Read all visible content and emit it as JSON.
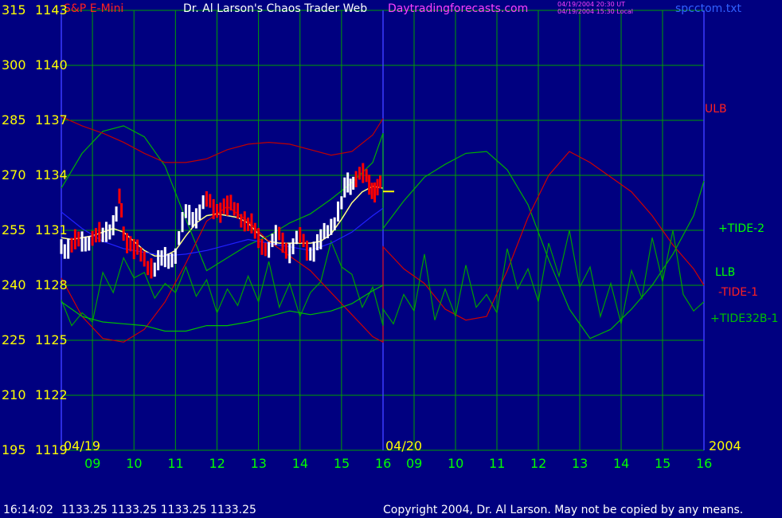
{
  "header": {
    "instrument": "S&P E-Mini",
    "site_title": "Dr. Al Larson's Chaos Trader Web",
    "site_url": "Daytradingforecasts.com",
    "stamp_ut": "04/19/2004 20:30 UT",
    "stamp_local": "04/19/2004 15:30 Local",
    "filename": "spcctom.txt"
  },
  "colors": {
    "background": "#000080",
    "grid": "#00a000",
    "divider": "#3a3aff",
    "price_up": "#ffffff",
    "price_down": "#ff0000",
    "average": "#ffff80",
    "tide_2": "#00b000",
    "tide_1": "#d00000",
    "tide32b_1": "#00a000",
    "band_upper": "#c00000",
    "band_lower": "#00c000",
    "blue_band": "#2020ff"
  },
  "axes": {
    "y_left_outer": [
      "315",
      "300",
      "285",
      "270",
      "255",
      "240",
      "225",
      "210",
      "195"
    ],
    "y_left_inner": [
      "1143",
      "1140",
      "1137",
      "1134",
      "1131",
      "1128",
      "1125",
      "1122",
      "1119"
    ],
    "x_day1_label": "04/19",
    "x_day2_label": "04/20",
    "x_year_label": "2004",
    "x_hours": [
      "09",
      "10",
      "11",
      "12",
      "13",
      "14",
      "15",
      "16",
      "09",
      "10",
      "11",
      "12",
      "13",
      "14",
      "15",
      "16"
    ]
  },
  "right_labels": {
    "ulb": "ULB",
    "tide_2": "+TIDE-2",
    "llb": "LLB",
    "tide_1": "-TIDE-1",
    "tide32b_1": "+TIDE32B-1"
  },
  "footer": {
    "time": "16:14:02",
    "quote": "1133.25 1133.25 1133.25 1133.25",
    "copyright": "Copyright 2004, Dr. Al Larson. May not be copied by any means."
  },
  "chart_data": {
    "type": "line",
    "title": "Dr. Al Larson's Chaos Trader Web",
    "xlabel": "",
    "ylabel": "",
    "ylim": [
      1119,
      1143
    ],
    "y2lim": [
      195,
      315
    ],
    "grid": true,
    "x_hours": [
      "09",
      "10",
      "11",
      "12",
      "13",
      "14",
      "15",
      "16",
      "09",
      "10",
      "11",
      "12",
      "13",
      "14",
      "15",
      "16"
    ],
    "x_range_hours": [
      8.25,
      16.0
    ],
    "series": [
      {
        "name": "S&P E-Mini",
        "kind": "price",
        "x": [
          8.25,
          8.5,
          8.75,
          9.0,
          9.25,
          9.5,
          9.65,
          9.75,
          10.0,
          10.25,
          10.5,
          10.75,
          11.0,
          11.25,
          11.5,
          11.75,
          12.0,
          12.25,
          12.5,
          12.75,
          13.0,
          13.25,
          13.5,
          13.75,
          14.0,
          14.25,
          14.5,
          14.75,
          15.0,
          15.15,
          15.35,
          15.6,
          15.8,
          16.0
        ],
        "values": [
          1130.0,
          1130.4,
          1130.1,
          1130.9,
          1130.4,
          1131.6,
          1132.6,
          1131.0,
          1129.9,
          1129.4,
          1129.0,
          1129.3,
          1129.9,
          1131.7,
          1132.0,
          1132.4,
          1132.3,
          1132.2,
          1132.1,
          1131.4,
          1130.4,
          1130.2,
          1130.5,
          1130.1,
          1130.4,
          1130.0,
          1130.3,
          1131.3,
          1132.5,
          1133.5,
          1134.0,
          1133.7,
          1133.4,
          1133.25
        ]
      },
      {
        "name": "Average",
        "kind": "average",
        "x": [
          8.25,
          8.5,
          8.75,
          9.0,
          9.25,
          9.5,
          9.75,
          10.0,
          10.25,
          10.5,
          10.75,
          11.0,
          11.25,
          11.5,
          11.75,
          12.0,
          12.25,
          12.5,
          12.75,
          13.0,
          13.25,
          13.5,
          13.75,
          14.0,
          14.25,
          14.5,
          14.75,
          15.0,
          15.25,
          15.5,
          15.75,
          16.0
        ],
        "values": [
          1130.6,
          1130.5,
          1130.6,
          1130.7,
          1130.9,
          1131.1,
          1130.9,
          1130.4,
          1129.9,
          1129.6,
          1129.6,
          1129.9,
          1130.7,
          1131.4,
          1131.8,
          1131.9,
          1131.8,
          1131.7,
          1131.4,
          1130.8,
          1130.4,
          1130.3,
          1130.3,
          1130.3,
          1130.3,
          1130.4,
          1130.8,
          1131.6,
          1132.5,
          1133.1,
          1133.4,
          1133.3
        ]
      },
      {
        "name": "+TIDE-2",
        "kind": "model",
        "x": [
          8.25,
          8.75,
          9.25,
          9.75,
          10.25,
          10.75,
          11.25,
          11.75,
          12.25,
          12.75,
          13.25,
          13.75,
          14.25,
          14.75,
          15.25,
          15.75,
          16.0,
          16.25,
          16.75,
          17.25,
          17.75,
          18.25,
          18.75,
          19.25,
          19.75,
          20.25,
          20.75,
          21.25,
          21.75,
          22.25,
          22.75,
          23.25,
          23.75,
          24.0
        ],
        "values": [
          1133.3,
          1135.2,
          1136.4,
          1136.7,
          1136.1,
          1134.5,
          1131.6,
          1128.8,
          1129.5,
          1130.2,
          1130.7,
          1131.4,
          1131.9,
          1132.7,
          1133.6,
          1134.7,
          1136.3,
          1131.1,
          1132.6,
          1133.9,
          1134.6,
          1135.2,
          1135.3,
          1134.3,
          1132.4,
          1129.4,
          1126.7,
          1125.1,
          1125.6,
          1126.7,
          1128.0,
          1129.7,
          1131.8,
          1133.7
        ]
      },
      {
        "name": "-TIDE-1",
        "kind": "model",
        "x": [
          8.25,
          8.75,
          9.25,
          9.75,
          10.25,
          10.75,
          11.25,
          11.75,
          12.25,
          12.75,
          13.25,
          13.75,
          14.25,
          14.75,
          15.25,
          15.75,
          16.0,
          16.25,
          16.75,
          17.25,
          17.75,
          18.25,
          18.75,
          19.25,
          19.75,
          20.25,
          20.75,
          21.25,
          21.75,
          22.25,
          22.75,
          23.25,
          23.75,
          24.0
        ],
        "values": [
          1128.4,
          1126.3,
          1125.1,
          1124.9,
          1125.6,
          1127.1,
          1129.2,
          1131.5,
          1132.3,
          1131.5,
          1130.4,
          1129.6,
          1128.8,
          1127.6,
          1126.4,
          1125.2,
          1124.9,
          1130.1,
          1128.9,
          1128.1,
          1126.7,
          1126.1,
          1126.3,
          1128.8,
          1131.7,
          1134.0,
          1135.3,
          1134.7,
          1133.9,
          1133.1,
          1131.8,
          1130.2,
          1128.9,
          1128.0
        ]
      },
      {
        "name": "+TIDE32B-1",
        "kind": "model",
        "x": [
          8.25,
          8.5,
          8.75,
          9.0,
          9.25,
          9.5,
          9.75,
          10.0,
          10.25,
          10.5,
          10.75,
          11.0,
          11.25,
          11.5,
          11.75,
          12.0,
          12.25,
          12.5,
          12.75,
          13.0,
          13.25,
          13.5,
          13.75,
          14.0,
          14.25,
          14.5,
          14.75,
          15.0,
          15.25,
          15.5,
          15.75,
          16.0,
          16.25,
          16.5,
          16.75,
          17.0,
          17.25,
          17.5,
          17.75,
          18.0,
          18.25,
          18.5,
          18.75,
          19.0,
          19.25,
          19.5,
          19.75,
          20.0,
          20.25,
          20.5,
          20.75,
          21.0,
          21.25,
          21.5,
          21.75,
          22.0,
          22.25,
          22.5,
          22.75,
          23.0,
          23.25,
          23.5,
          23.75,
          24.0
        ],
        "values": [
          1127.2,
          1125.8,
          1126.5,
          1126.0,
          1128.7,
          1127.6,
          1129.5,
          1128.4,
          1128.7,
          1127.3,
          1128.1,
          1127.6,
          1129.0,
          1127.4,
          1128.3,
          1126.5,
          1127.8,
          1126.9,
          1128.5,
          1127.1,
          1129.3,
          1126.8,
          1128.1,
          1126.3,
          1127.6,
          1128.2,
          1130.4,
          1129.0,
          1128.6,
          1126.8,
          1127.9,
          1125.8,
          1126.7,
          1125.9,
          1127.5,
          1126.6,
          1129.7,
          1126.1,
          1127.8,
          1126.3,
          1129.1,
          1126.8,
          1127.5,
          1126.5,
          1130.0,
          1127.8,
          1128.9,
          1127.1,
          1130.3,
          1128.5,
          1131.0,
          1127.9,
          1129.0,
          1126.3,
          1128.1,
          1125.9,
          1128.8,
          1127.3,
          1130.6,
          1128.2,
          1131.0,
          1127.5,
          1126.6,
          1127.1
        ]
      },
      {
        "name": "ULB",
        "kind": "band",
        "x": [
          8.25,
          8.75,
          9.25,
          9.75,
          10.25,
          10.75,
          11.25,
          11.75,
          12.25,
          12.75,
          13.25,
          13.75,
          14.25,
          14.75,
          15.25,
          15.75,
          16.0
        ],
        "values": [
          1137.2,
          1136.7,
          1136.3,
          1135.8,
          1135.2,
          1134.7,
          1134.7,
          1134.9,
          1135.4,
          1135.7,
          1135.8,
          1135.7,
          1135.4,
          1135.1,
          1135.3,
          1136.2,
          1137.1
        ]
      },
      {
        "name": "LLB",
        "kind": "band",
        "x": [
          8.25,
          8.75,
          9.25,
          9.75,
          10.25,
          10.75,
          11.25,
          11.75,
          12.25,
          12.75,
          13.25,
          13.75,
          14.25,
          14.75,
          15.25,
          15.75,
          16.0
        ],
        "values": [
          1127.1,
          1126.3,
          1126.0,
          1125.9,
          1125.8,
          1125.5,
          1125.5,
          1125.8,
          1125.8,
          1126.0,
          1126.3,
          1126.6,
          1126.4,
          1126.6,
          1127.0,
          1127.7,
          1128.0
        ]
      },
      {
        "name": "Blue band",
        "kind": "blue",
        "x": [
          8.25,
          8.75,
          9.25,
          9.75,
          10.25,
          10.75,
          11.25,
          11.75,
          12.25,
          12.75,
          13.25,
          13.75,
          14.25,
          14.75,
          15.25,
          15.75,
          16.0
        ],
        "values": [
          1132.0,
          1131.1,
          1130.4,
          1130.0,
          1129.8,
          1129.6,
          1129.7,
          1129.9,
          1130.2,
          1130.5,
          1130.3,
          1130.1,
          1129.9,
          1130.3,
          1130.9,
          1131.8,
          1132.2
        ]
      }
    ]
  }
}
